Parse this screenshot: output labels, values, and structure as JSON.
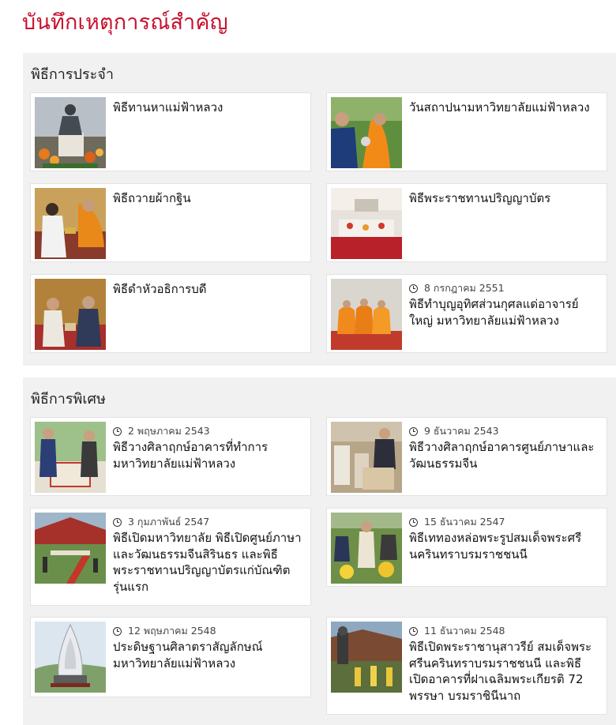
{
  "page": {
    "title": "บันทึกเหตุการณ์สำคัญ"
  },
  "sections": [
    {
      "title": "พิธีการประจำ",
      "items": [
        {
          "title": "พิธีทานหาแม่ฟ้าหลวง",
          "date": ""
        },
        {
          "title": "วันสถาปนามหาวิทยาลัยแม่ฟ้าหลวง",
          "date": ""
        },
        {
          "title": "พิธีถวายผ้ากฐิน",
          "date": ""
        },
        {
          "title": "พิธีพระราชทานปริญญาบัตร",
          "date": ""
        },
        {
          "title": "พิธีดำหัวอธิการบดี",
          "date": ""
        },
        {
          "title": "พิธีทำบุญอุทิศส่วนกุศลแด่อาจารย์ใหญ่ มหาวิทยาลัยแม่ฟ้าหลวง",
          "date": "8 กรกฎาคม 2551"
        }
      ]
    },
    {
      "title": "พิธีการพิเศษ",
      "items": [
        {
          "title": "พิธีวางศิลาฤกษ์อาคารที่ทำการมหาวิทยาลัยแม่ฟ้าหลวง",
          "date": "2 พฤษภาคม 2543"
        },
        {
          "title": "พิธีวางศิลาฤกษ์อาคารศูนย์ภาษาและวัฒนธรรมจีน",
          "date": "9 ธันวาคม 2543"
        },
        {
          "title": "พิธีเปิดมหาวิทยาลัย พิธีเปิดศูนย์ภาษาและวัฒนธรรมจีนสิรินธร และพิธีพระราชทานปริญญาบัตรแก่บัณฑิตรุ่นแรก",
          "date": "3 กุมภาพันธ์ 2547"
        },
        {
          "title": "พิธีเททองหล่อพระรูปสมเด็จพระศรีนครินทราบรมราชชนนี",
          "date": "15 ธันวาคม 2547"
        },
        {
          "title": "ประดิษฐานศิลาตราสัญลักษณ์มหาวิทยาลัยแม่ฟ้าหลวง",
          "date": "12 พฤษภาคม 2548"
        },
        {
          "title": "พิธีเปิดพระราชานุสาวรีย์ สมเด็จพระศรีนครินทราบรมราชชนนี และพิธีเปิดอาคารที่ฝาเฉลิมพระเกียรติ 72 พรรษา บรมราชินีนาถ",
          "date": "11 ธันวาคม 2548"
        }
      ]
    }
  ]
}
